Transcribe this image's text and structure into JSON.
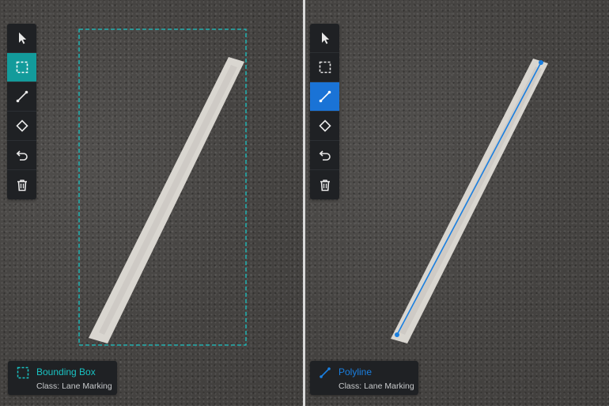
{
  "colors": {
    "bbox_accent": "#19c3c3",
    "polyline_accent": "#1a7fe0",
    "toolbar_bg": "#1f2124",
    "active_teal": "#139b9b",
    "active_blue": "#1a73d6"
  },
  "left_panel": {
    "active_tool": "bounding-box",
    "tools": [
      "select-cursor-icon",
      "bounding-box-icon",
      "line-icon",
      "polygon-icon",
      "undo-icon",
      "trash-icon"
    ],
    "label": {
      "icon": "bounding-box-icon",
      "title": "Bounding Box",
      "class_text": "Class: Lane Marking"
    }
  },
  "right_panel": {
    "active_tool": "polyline",
    "tools": [
      "select-cursor-icon",
      "bounding-box-icon",
      "line-icon",
      "polygon-icon",
      "undo-icon",
      "trash-icon"
    ],
    "label": {
      "icon": "polyline-icon",
      "title": "Polyline",
      "class_text": "Class: Lane Marking"
    }
  }
}
